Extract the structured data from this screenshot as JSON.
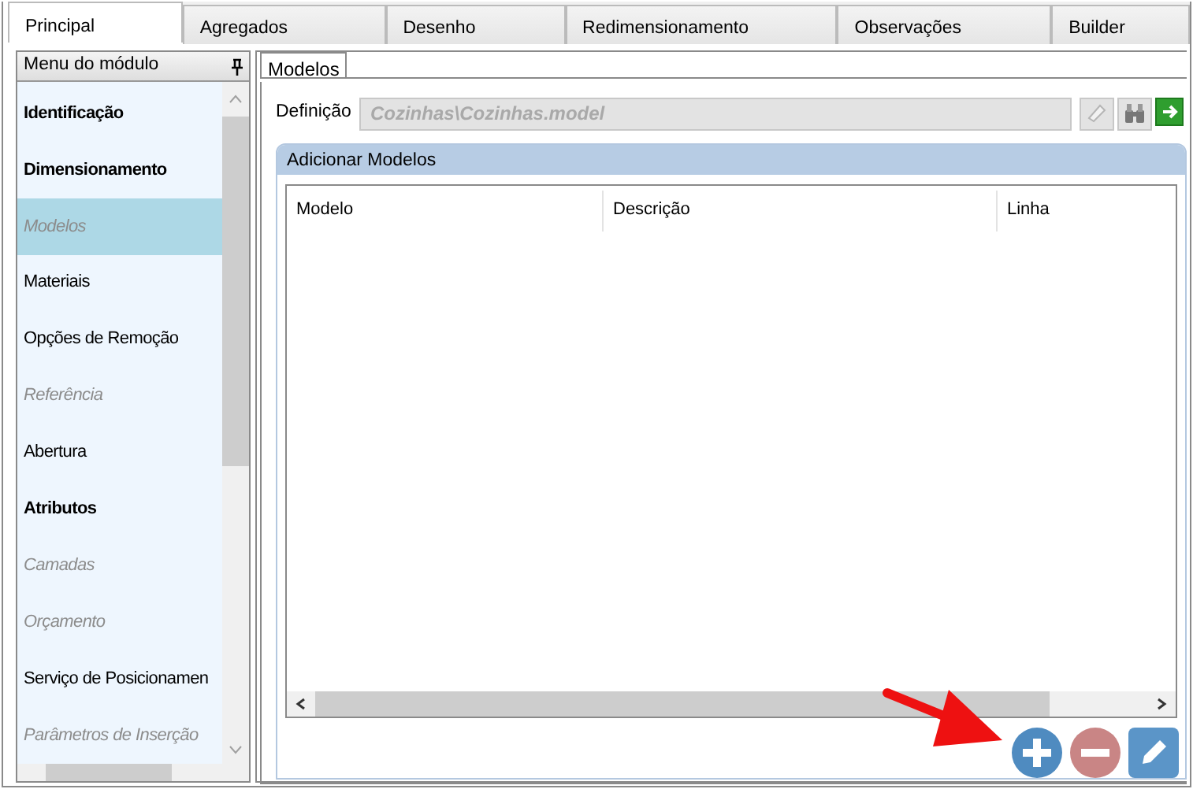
{
  "tabs": [
    {
      "label": "Principal",
      "selected": true
    },
    {
      "label": "Agregados",
      "selected": false
    },
    {
      "label": "Desenho",
      "selected": false
    },
    {
      "label": "Redimensionamento",
      "selected": false
    },
    {
      "label": "Observações",
      "selected": false
    },
    {
      "label": "Builder",
      "selected": false
    }
  ],
  "module_menu": {
    "title": "Menu do módulo",
    "items": [
      {
        "label": "Identificação",
        "bold": true,
        "disabled": false,
        "selected": false
      },
      {
        "label": "Dimensionamento",
        "bold": true,
        "disabled": false,
        "selected": false
      },
      {
        "label": "Modelos",
        "bold": false,
        "disabled": true,
        "selected": true
      },
      {
        "label": "Materiais",
        "bold": false,
        "disabled": false,
        "selected": false
      },
      {
        "label": "Opções de Remoção",
        "bold": false,
        "disabled": false,
        "selected": false
      },
      {
        "label": "Referência",
        "bold": false,
        "disabled": true,
        "selected": false
      },
      {
        "label": "Abertura",
        "bold": false,
        "disabled": false,
        "selected": false
      },
      {
        "label": "Atributos",
        "bold": true,
        "disabled": false,
        "selected": false
      },
      {
        "label": "Camadas",
        "bold": false,
        "disabled": true,
        "selected": false
      },
      {
        "label": "Orçamento",
        "bold": false,
        "disabled": true,
        "selected": false
      },
      {
        "label": "Serviço de Posicionamen",
        "bold": false,
        "disabled": false,
        "selected": false
      },
      {
        "label": "Parâmetros de Inserção",
        "bold": false,
        "disabled": true,
        "selected": false
      }
    ]
  },
  "sub_tabs": [
    {
      "label": "Modelos",
      "selected": true
    }
  ],
  "definition": {
    "label": "Definição",
    "value": "Cozinhas\\Cozinhas.model"
  },
  "group": {
    "title": "Adicionar Modelos",
    "table": {
      "columns": [
        "Modelo",
        "Descrição",
        "Linha"
      ]
    }
  }
}
